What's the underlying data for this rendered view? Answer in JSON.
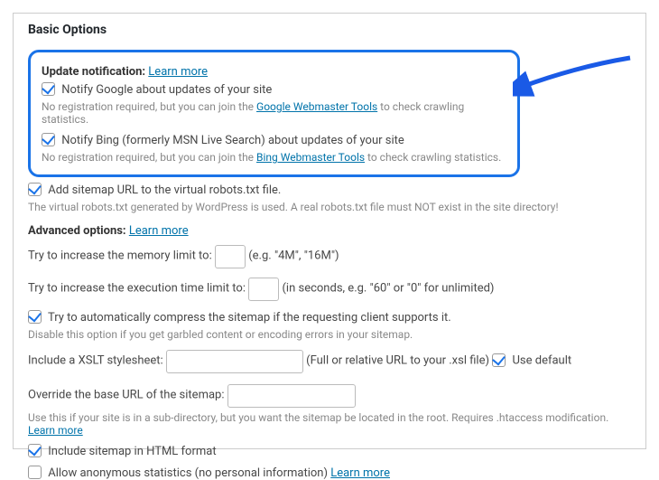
{
  "section_title": "Basic Options",
  "update_notification": {
    "heading": "Update notification:",
    "learn_more": "Learn more",
    "google": {
      "label": "Notify Google about updates of your site",
      "checked": true,
      "note_pre": "No registration required, but you can join the ",
      "tools_link": "Google Webmaster Tools",
      "note_post": " to check crawling statistics."
    },
    "bing": {
      "label": "Notify Bing (formerly MSN Live Search) about updates of your site",
      "checked": true,
      "note_pre": "No registration required, but you can join the ",
      "tools_link": "Bing Webmaster Tools",
      "note_post": " to check crawling statistics."
    }
  },
  "virtual_robots": {
    "label": "Add sitemap URL to the virtual robots.txt file.",
    "checked": true,
    "note": "The virtual robots.txt generated by WordPress is used. A real robots.txt file must NOT exist in the site directory!"
  },
  "advanced": {
    "heading": "Advanced options:",
    "learn_more": "Learn more",
    "memory": {
      "label_pre": "Try to increase the memory limit to:",
      "value": "",
      "hint": "(e.g. \"4M\", \"16M\")"
    },
    "exec": {
      "label_pre": "Try to increase the execution time limit to:",
      "value": "",
      "hint": "(in seconds, e.g. \"60\" or \"0\" for unlimited)"
    },
    "compress": {
      "label": "Try to automatically compress the sitemap if the requesting client supports it.",
      "checked": true,
      "note": "Disable this option if you get garbled content or encoding errors in your sitemap."
    },
    "xslt": {
      "label": "Include a XSLT stylesheet:",
      "value": "",
      "hint": "(Full or relative URL to your .xsl file)",
      "use_default_label": "Use default",
      "use_default_checked": true
    },
    "base_url": {
      "label": "Override the base URL of the sitemap:",
      "value": "",
      "note_pre": "Use this if your site is in a sub-directory, but you want the sitemap be located in the root. Requires .htaccess modification. ",
      "learn_more": "Learn more"
    },
    "html_format": {
      "label": "Include sitemap in HTML format",
      "checked": true
    },
    "anon_stats": {
      "label": "Allow anonymous statistics (no personal information)",
      "checked": false,
      "learn_more": "Learn more"
    }
  }
}
